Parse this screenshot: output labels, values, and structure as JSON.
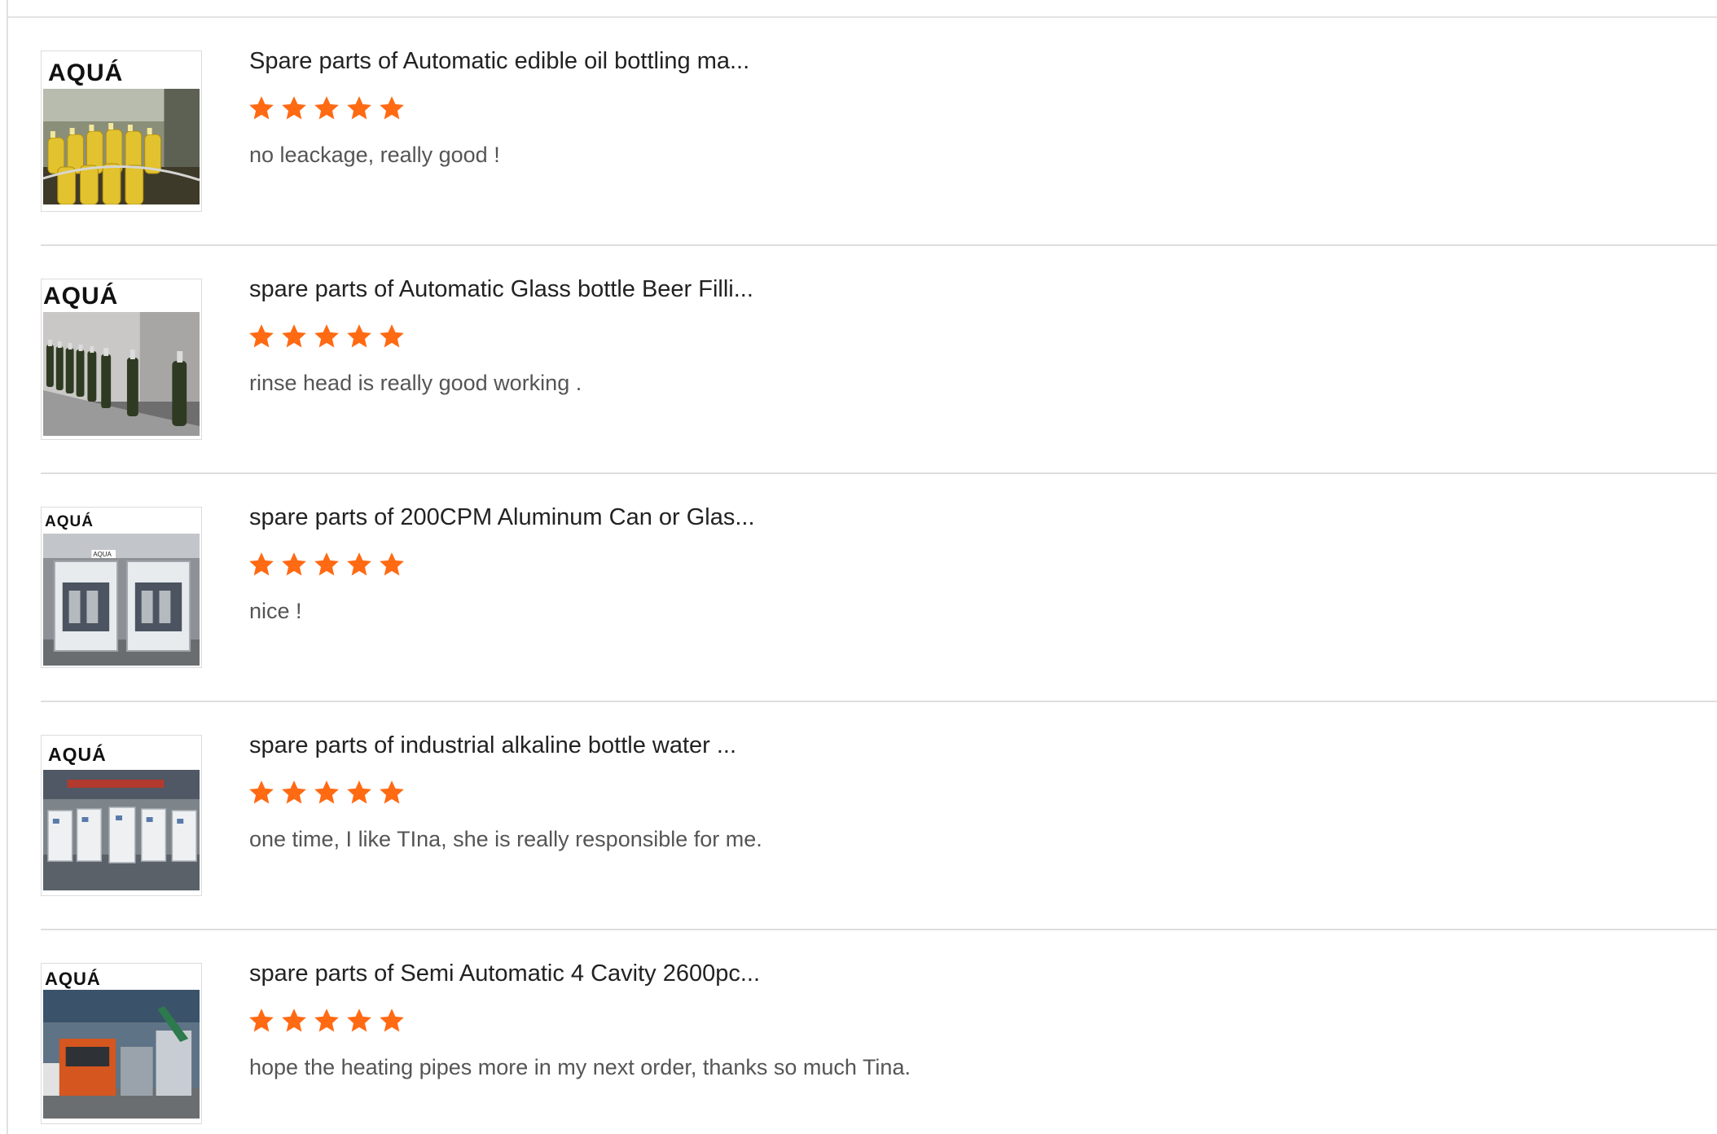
{
  "colors": {
    "star": "#ff6a13",
    "title": "#222222",
    "comment": "#555555",
    "divider": "#dedede"
  },
  "reviews": [
    {
      "brand": "AQUÁ",
      "title": "Spare parts of Automatic edible oil bottling ma...",
      "rating": 5,
      "comment": "no leackage, really good !"
    },
    {
      "brand": "AQUÁ",
      "title": "spare parts of Automatic Glass bottle Beer Filli...",
      "rating": 5,
      "comment": "rinse head is really good working ."
    },
    {
      "brand": "AQUÁ",
      "title": "spare parts of 200CPM Aluminum Can or Glas...",
      "rating": 5,
      "comment": "nice !"
    },
    {
      "brand": "AQUÁ",
      "title": "spare parts of industrial alkaline bottle water ...",
      "rating": 5,
      "comment": "one time, I like TIna, she is really responsible for me."
    },
    {
      "brand": "AQUÁ",
      "title": "spare parts of Semi Automatic 4 Cavity 2600pc...",
      "rating": 5,
      "comment": "hope the heating pipes more in my next order, thanks so much Tina."
    }
  ]
}
